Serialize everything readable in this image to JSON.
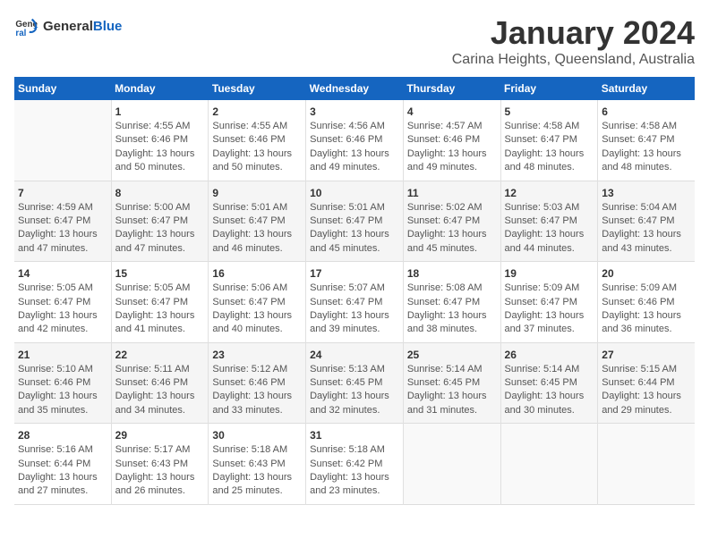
{
  "logo": {
    "text_general": "General",
    "text_blue": "Blue"
  },
  "header": {
    "title": "January 2024",
    "subtitle": "Carina Heights, Queensland, Australia"
  },
  "weekdays": [
    "Sunday",
    "Monday",
    "Tuesday",
    "Wednesday",
    "Thursday",
    "Friday",
    "Saturday"
  ],
  "weeks": [
    [
      {
        "day": "",
        "info": ""
      },
      {
        "day": "1",
        "info": "Sunrise: 4:55 AM\nSunset: 6:46 PM\nDaylight: 13 hours\nand 50 minutes."
      },
      {
        "day": "2",
        "info": "Sunrise: 4:55 AM\nSunset: 6:46 PM\nDaylight: 13 hours\nand 50 minutes."
      },
      {
        "day": "3",
        "info": "Sunrise: 4:56 AM\nSunset: 6:46 PM\nDaylight: 13 hours\nand 49 minutes."
      },
      {
        "day": "4",
        "info": "Sunrise: 4:57 AM\nSunset: 6:46 PM\nDaylight: 13 hours\nand 49 minutes."
      },
      {
        "day": "5",
        "info": "Sunrise: 4:58 AM\nSunset: 6:47 PM\nDaylight: 13 hours\nand 48 minutes."
      },
      {
        "day": "6",
        "info": "Sunrise: 4:58 AM\nSunset: 6:47 PM\nDaylight: 13 hours\nand 48 minutes."
      }
    ],
    [
      {
        "day": "7",
        "info": "Sunrise: 4:59 AM\nSunset: 6:47 PM\nDaylight: 13 hours\nand 47 minutes."
      },
      {
        "day": "8",
        "info": "Sunrise: 5:00 AM\nSunset: 6:47 PM\nDaylight: 13 hours\nand 47 minutes."
      },
      {
        "day": "9",
        "info": "Sunrise: 5:01 AM\nSunset: 6:47 PM\nDaylight: 13 hours\nand 46 minutes."
      },
      {
        "day": "10",
        "info": "Sunrise: 5:01 AM\nSunset: 6:47 PM\nDaylight: 13 hours\nand 45 minutes."
      },
      {
        "day": "11",
        "info": "Sunrise: 5:02 AM\nSunset: 6:47 PM\nDaylight: 13 hours\nand 45 minutes."
      },
      {
        "day": "12",
        "info": "Sunrise: 5:03 AM\nSunset: 6:47 PM\nDaylight: 13 hours\nand 44 minutes."
      },
      {
        "day": "13",
        "info": "Sunrise: 5:04 AM\nSunset: 6:47 PM\nDaylight: 13 hours\nand 43 minutes."
      }
    ],
    [
      {
        "day": "14",
        "info": "Sunrise: 5:05 AM\nSunset: 6:47 PM\nDaylight: 13 hours\nand 42 minutes."
      },
      {
        "day": "15",
        "info": "Sunrise: 5:05 AM\nSunset: 6:47 PM\nDaylight: 13 hours\nand 41 minutes."
      },
      {
        "day": "16",
        "info": "Sunrise: 5:06 AM\nSunset: 6:47 PM\nDaylight: 13 hours\nand 40 minutes."
      },
      {
        "day": "17",
        "info": "Sunrise: 5:07 AM\nSunset: 6:47 PM\nDaylight: 13 hours\nand 39 minutes."
      },
      {
        "day": "18",
        "info": "Sunrise: 5:08 AM\nSunset: 6:47 PM\nDaylight: 13 hours\nand 38 minutes."
      },
      {
        "day": "19",
        "info": "Sunrise: 5:09 AM\nSunset: 6:47 PM\nDaylight: 13 hours\nand 37 minutes."
      },
      {
        "day": "20",
        "info": "Sunrise: 5:09 AM\nSunset: 6:46 PM\nDaylight: 13 hours\nand 36 minutes."
      }
    ],
    [
      {
        "day": "21",
        "info": "Sunrise: 5:10 AM\nSunset: 6:46 PM\nDaylight: 13 hours\nand 35 minutes."
      },
      {
        "day": "22",
        "info": "Sunrise: 5:11 AM\nSunset: 6:46 PM\nDaylight: 13 hours\nand 34 minutes."
      },
      {
        "day": "23",
        "info": "Sunrise: 5:12 AM\nSunset: 6:46 PM\nDaylight: 13 hours\nand 33 minutes."
      },
      {
        "day": "24",
        "info": "Sunrise: 5:13 AM\nSunset: 6:45 PM\nDaylight: 13 hours\nand 32 minutes."
      },
      {
        "day": "25",
        "info": "Sunrise: 5:14 AM\nSunset: 6:45 PM\nDaylight: 13 hours\nand 31 minutes."
      },
      {
        "day": "26",
        "info": "Sunrise: 5:14 AM\nSunset: 6:45 PM\nDaylight: 13 hours\nand 30 minutes."
      },
      {
        "day": "27",
        "info": "Sunrise: 5:15 AM\nSunset: 6:44 PM\nDaylight: 13 hours\nand 29 minutes."
      }
    ],
    [
      {
        "day": "28",
        "info": "Sunrise: 5:16 AM\nSunset: 6:44 PM\nDaylight: 13 hours\nand 27 minutes."
      },
      {
        "day": "29",
        "info": "Sunrise: 5:17 AM\nSunset: 6:43 PM\nDaylight: 13 hours\nand 26 minutes."
      },
      {
        "day": "30",
        "info": "Sunrise: 5:18 AM\nSunset: 6:43 PM\nDaylight: 13 hours\nand 25 minutes."
      },
      {
        "day": "31",
        "info": "Sunrise: 5:18 AM\nSunset: 6:42 PM\nDaylight: 13 hours\nand 23 minutes."
      },
      {
        "day": "",
        "info": ""
      },
      {
        "day": "",
        "info": ""
      },
      {
        "day": "",
        "info": ""
      }
    ]
  ]
}
